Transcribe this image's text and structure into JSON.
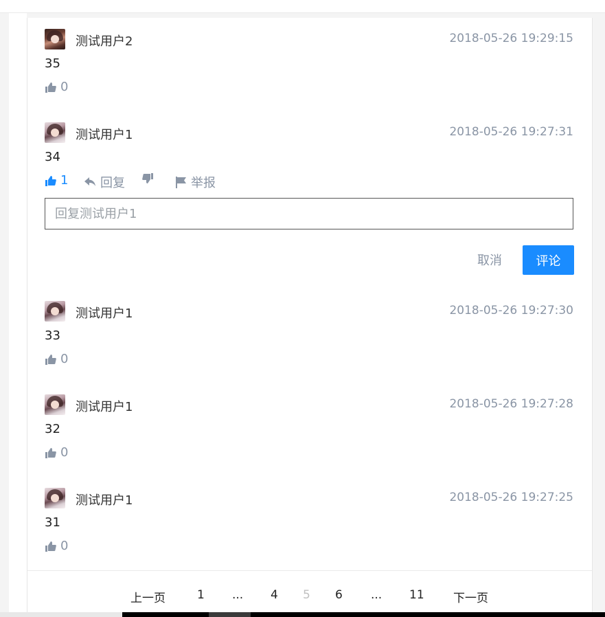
{
  "comments": [
    {
      "user": "测试用户2",
      "time": "2018-05-26 19:29:15",
      "text": "35",
      "likes": "0"
    },
    {
      "user": "测试用户1",
      "time": "2018-05-26 19:27:31",
      "text": "34",
      "likes": "1",
      "reply_label": "回复",
      "report_label": "举报"
    },
    {
      "user": "测试用户1",
      "time": "2018-05-26 19:27:30",
      "text": "33",
      "likes": "0"
    },
    {
      "user": "测试用户1",
      "time": "2018-05-26 19:27:28",
      "text": "32",
      "likes": "0"
    },
    {
      "user": "测试用户1",
      "time": "2018-05-26 19:27:25",
      "text": "31",
      "likes": "0"
    }
  ],
  "reply_form": {
    "placeholder": "回复测试用户1",
    "value": "",
    "cancel_label": "取消",
    "submit_label": "评论"
  },
  "pagination": {
    "prev_label": "上一页",
    "next_label": "下一页",
    "pages": [
      "1",
      "...",
      "4",
      "5",
      "6",
      "...",
      "11"
    ],
    "current": "5"
  },
  "colors": {
    "accent": "#1a8cff",
    "muted": "#8a95a5"
  },
  "icons": {
    "like": "thumbs-up-icon",
    "reply": "reply-arrow-icon",
    "dislike": "thumbs-down-icon",
    "report": "flag-icon"
  }
}
